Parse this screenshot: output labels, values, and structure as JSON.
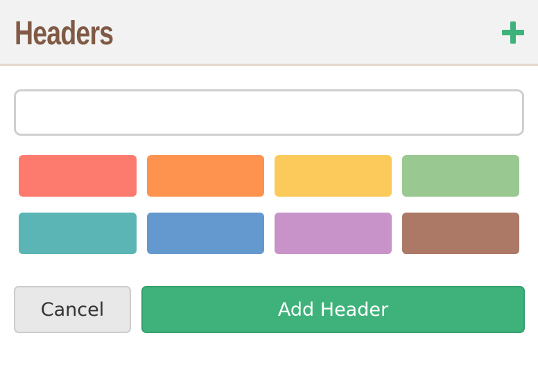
{
  "header": {
    "title": "Headers",
    "add_icon": "plus-icon",
    "add_icon_color": "#3fb27b"
  },
  "name_input": {
    "value": "",
    "placeholder": ""
  },
  "color_swatches": [
    {
      "name": "red",
      "color": "#fc7b6e"
    },
    {
      "name": "orange",
      "color": "#fd934f"
    },
    {
      "name": "yellow",
      "color": "#fbca5a"
    },
    {
      "name": "green",
      "color": "#99c991"
    },
    {
      "name": "teal",
      "color": "#5bb5b5"
    },
    {
      "name": "blue",
      "color": "#6499d0"
    },
    {
      "name": "purple",
      "color": "#c893c8"
    },
    {
      "name": "brown",
      "color": "#ab7966"
    }
  ],
  "actions": {
    "cancel_label": "Cancel",
    "submit_label": "Add Header"
  },
  "colors": {
    "title": "#805a45",
    "accent": "#3fb27b",
    "header_background": "#f2f2f2"
  }
}
